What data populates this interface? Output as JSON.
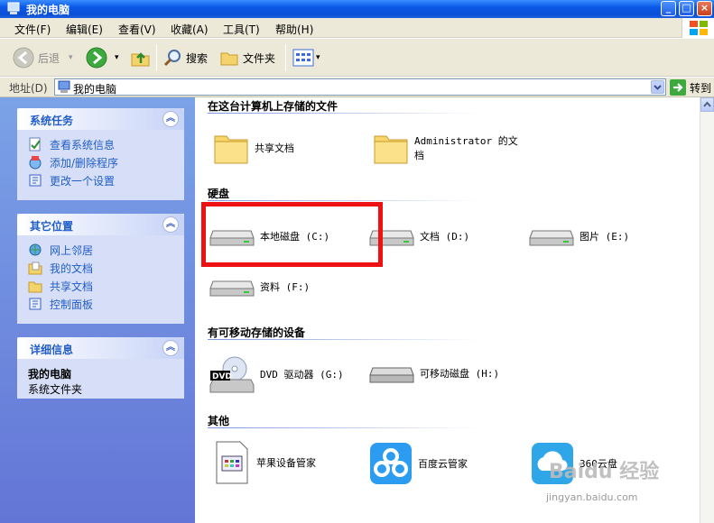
{
  "window": {
    "title": "我的电脑",
    "min": "_",
    "max": "□",
    "close": "×"
  },
  "menu": [
    "文件(F)",
    "编辑(E)",
    "查看(V)",
    "收藏(A)",
    "工具(T)",
    "帮助(H)"
  ],
  "toolbar": {
    "back": "后退",
    "search": "搜索",
    "folders": "文件夹"
  },
  "address": {
    "label": "地址(D)",
    "value": "我的电脑",
    "go": "转到"
  },
  "sidebar": {
    "system_tasks": {
      "title": "系统任务",
      "items": [
        "查看系统信息",
        "添加/删除程序",
        "更改一个设置"
      ]
    },
    "other_places": {
      "title": "其它位置",
      "items": [
        "网上邻居",
        "我的文档",
        "共享文档",
        "控制面板"
      ]
    },
    "details": {
      "title": "详细信息",
      "name": "我的电脑",
      "sub": "系统文件夹"
    }
  },
  "main": {
    "stored_files": {
      "title": "在这台计算机上存储的文件",
      "items": [
        "共享文档",
        "Administrator 的文档"
      ]
    },
    "hard_disks": {
      "title": "硬盘",
      "items": [
        "本地磁盘 (C:)",
        "文档 (D:)",
        "图片 (E:)",
        "资料 (F:)"
      ]
    },
    "removable": {
      "title": "有可移动存储的设备",
      "items": [
        "DVD 驱动器 (G:)",
        "可移动磁盘 (H:)"
      ]
    },
    "other": {
      "title": "其他",
      "items": [
        "苹果设备管家",
        "百度云管家",
        "360云盘"
      ]
    }
  },
  "watermark": {
    "text": "Baidu 经验",
    "url": "jingyan.baidu.com"
  },
  "colors": {
    "titlebar": "#0a58e6",
    "sidebar_bg": "#6375d6",
    "task_link": "#215dc6",
    "highlight_box": "#ee1111"
  }
}
